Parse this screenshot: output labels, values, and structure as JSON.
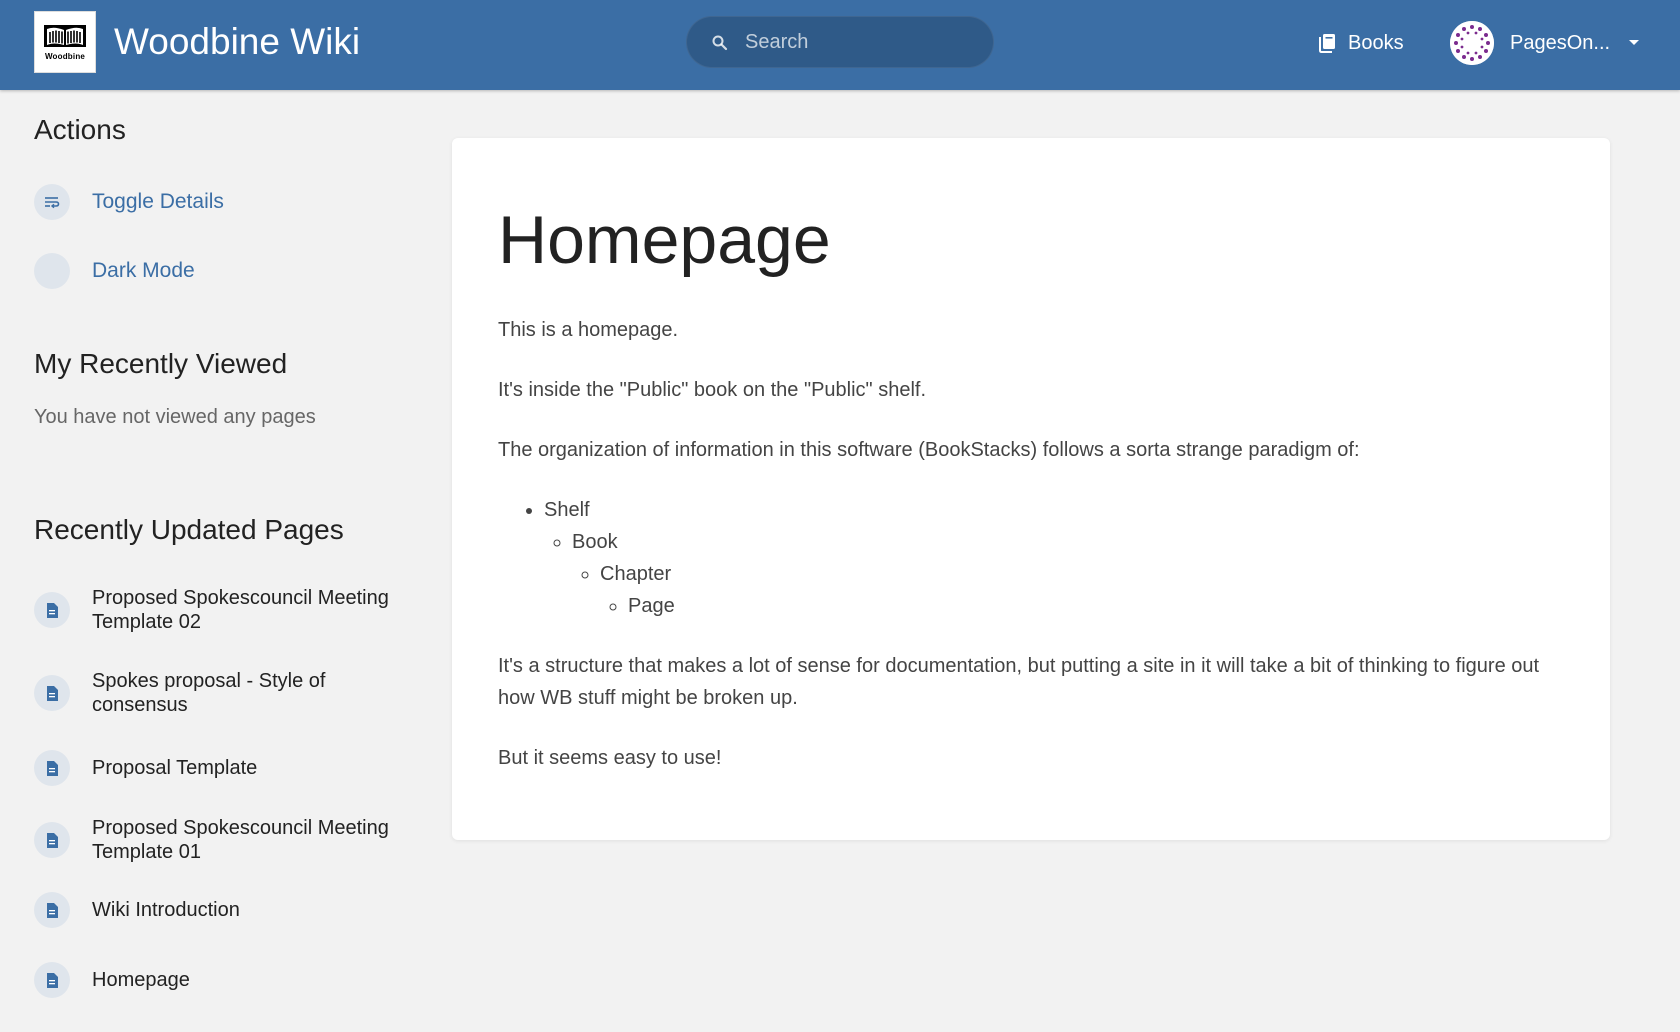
{
  "header": {
    "logo_text": "Woodbine",
    "site_title": "Woodbine Wiki",
    "search_placeholder": "Search",
    "books_label": "Books",
    "user_name": "PagesOn..."
  },
  "sidebar": {
    "actions_title": "Actions",
    "actions": [
      {
        "label": "Toggle Details",
        "icon": "toggle-details-icon"
      },
      {
        "label": "Dark Mode",
        "icon": "dark-mode-icon"
      }
    ],
    "recent_title": "My Recently Viewed",
    "recent_empty": "You have not viewed any pages",
    "updated_title": "Recently Updated Pages",
    "updated_pages": [
      {
        "label": "Proposed Spokescouncil Meeting Template 02"
      },
      {
        "label": "Spokes proposal - Style of consensus"
      },
      {
        "label": "Proposal Template"
      },
      {
        "label": "Proposed Spokescouncil Meeting Template 01"
      },
      {
        "label": "Wiki Introduction"
      },
      {
        "label": "Homepage"
      }
    ]
  },
  "page": {
    "title": "Homepage",
    "paragraphs": [
      "This is a homepage.",
      "It's inside the \"Public\" book on the \"Public\" shelf.",
      "The organization of information in this software (BookStacks) follows a sorta strange paradigm of:",
      "It's a structure that makes a lot of sense for documentation, but putting a site in it will take a bit of thinking to figure out how WB stuff might be broken up.",
      "But it seems easy to use!"
    ],
    "hierarchy": [
      "Shelf",
      "Book",
      "Chapter",
      "Page"
    ]
  },
  "colors": {
    "header_bg": "#3b6ea5",
    "link": "#3b6ea5",
    "page_bg": "#f2f2f2"
  }
}
